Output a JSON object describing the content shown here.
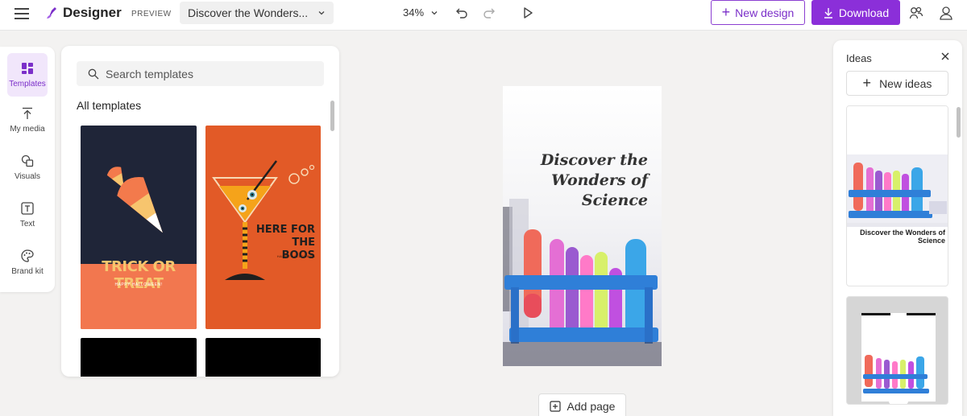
{
  "app": {
    "name": "Designer",
    "badge": "PREVIEW"
  },
  "header": {
    "doc_title": "Discover the Wonders...",
    "zoom": "34%",
    "new_design_label": "New design",
    "download_label": "Download"
  },
  "rail": {
    "items": [
      {
        "label": "Templates",
        "icon": "templates-icon"
      },
      {
        "label": "My media",
        "icon": "upload-icon"
      },
      {
        "label": "Visuals",
        "icon": "shapes-icon"
      },
      {
        "label": "Text",
        "icon": "text-icon"
      },
      {
        "label": "Brand kit",
        "icon": "palette-icon"
      }
    ]
  },
  "templates_panel": {
    "search_placeholder": "Search templates",
    "section_title": "All templates",
    "cards": [
      {
        "headline": "TRICK OR TREAT",
        "sub": "HAPPY HALLOWEEN!"
      },
      {
        "headline": "HERE FOR THE BOOS",
        "sub": "HAPPY HALLOWEEN"
      }
    ]
  },
  "canvas": {
    "title": "Discover the Wonders of Science",
    "add_page_label": "Add page"
  },
  "ideas_panel": {
    "title": "Ideas",
    "new_ideas_label": "New ideas",
    "cards": [
      {
        "caption": "Discover the Wonders of Science"
      }
    ]
  },
  "colors": {
    "accent": "#8b2fd9",
    "accent_text": "#7b2fc9",
    "rail_active_bg": "#f1e6fb",
    "background": "#f3f2f1"
  }
}
